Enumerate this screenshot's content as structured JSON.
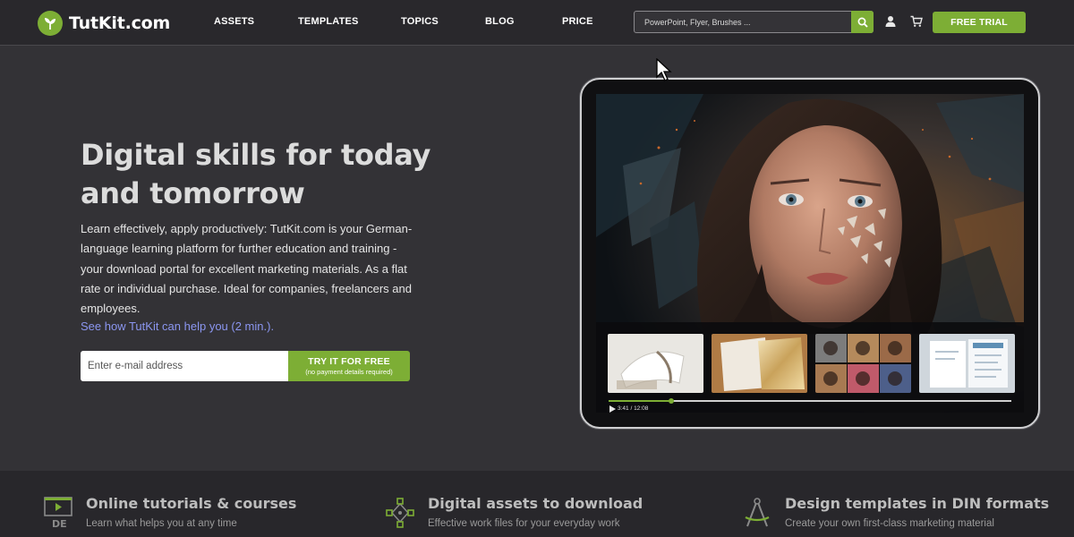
{
  "header": {
    "logo_text": "TutKit.com",
    "nav": [
      "ASSETS",
      "TEMPLATES",
      "TOPICS",
      "BLOG",
      "PRICE"
    ],
    "search_placeholder": "PowerPoint, Flyer, Brushes ...",
    "free_trial_label": "FREE TRIAL",
    "icons": [
      "search-icon",
      "user-icon",
      "cart-icon"
    ]
  },
  "hero": {
    "title": "Digital skills for today and tomorrow",
    "description": "Learn effectively, apply productively: TutKit.com is your German-language learning platform for further education and training - your download portal for excellent marketing materials. As a flat rate or individual purchase. Ideal for companies, freelancers and employees.",
    "link": "See how TutKit can help you (2 min.).",
    "email_placeholder": "Enter e-mail address",
    "cta_label": "TRY IT FOR FREE",
    "cta_sub": "(no payment details required)"
  },
  "video": {
    "time": "3:41 / 12:08",
    "progress": 0.156
  },
  "features": [
    {
      "icon": "video-play-icon",
      "icon_label": "DE",
      "title": "Online tutorials & courses",
      "subtitle": "Learn what helps you at any time"
    },
    {
      "icon": "vector-nodes-icon",
      "title": "Digital assets to download",
      "subtitle": "Effective work files for your everyday work"
    },
    {
      "icon": "compass-icon",
      "title": "Design templates in DIN formats",
      "subtitle": "Create your own first-class marketing material"
    }
  ],
  "colors": {
    "accent": "#7dae35",
    "background": "#333236",
    "header": "#29282c",
    "link": "#8b96f0"
  }
}
